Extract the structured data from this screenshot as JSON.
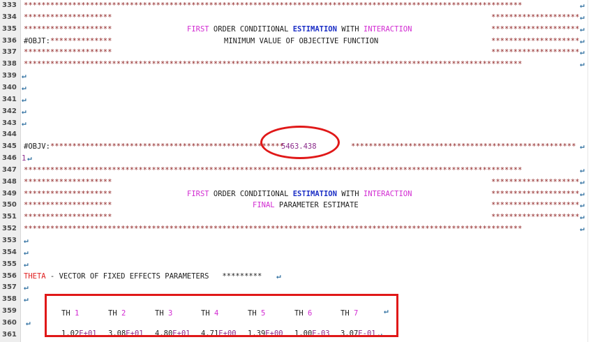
{
  "line_numbers": [
    "333",
    "334",
    "335",
    "336",
    "337",
    "338",
    "339",
    "340",
    "341",
    "342",
    "343",
    "344",
    "345",
    "346",
    "347",
    "348",
    "349",
    "350",
    "351",
    "352",
    "353",
    "354",
    "355",
    "356",
    "357",
    "358",
    "359",
    "360",
    "361"
  ],
  "stars_full": "*****************************************************************************************************************",
  "stars_block": "********************",
  "stars_objv_left": "*****************************************************",
  "stars_objv_right": "***************************************************",
  "objt_label": "#OBJT:",
  "objt_stars": "**************",
  "objv_label": "#OBJV:",
  "objv_value": "5463.438",
  "line346_prefix": "1",
  "heading": {
    "first": "FIRST",
    "order_conditional": " ORDER CONDITIONAL ",
    "estimation": "ESTIMATION",
    "with": " WITH ",
    "interaction": "INTERACTION"
  },
  "subtitle_objfn": "MINIMUM VALUE OF OBJECTIVE FUNCTION",
  "subtitle_final_word": "FINAL",
  "subtitle_final_rest": " PARAMETER ESTIMATE",
  "theta_word": "THETA",
  "theta_rest": " - VECTOR OF FIXED EFFECTS PARAMETERS   *********",
  "th_label": "TH",
  "th_indices": [
    "1",
    "2",
    "3",
    "4",
    "5",
    "6",
    "7"
  ],
  "th_values": [
    {
      "m": "1.02",
      "e": "E+01"
    },
    {
      "m": "3.08",
      "e": "E+01"
    },
    {
      "m": "4.80",
      "e": "E+01"
    },
    {
      "m": "4.71",
      "e": "E+00"
    },
    {
      "m": "1.39",
      "e": "E+00"
    },
    {
      "m": "1.00",
      "e": "E-03"
    },
    {
      "m": "3.07",
      "e": "E-01"
    }
  ],
  "return_glyph": "↵",
  "colors": {
    "star": "#8b1a1a",
    "pink": "#d22bd2",
    "blue": "#1c2fc6",
    "red": "#e02020",
    "annotation": "#e01818"
  }
}
